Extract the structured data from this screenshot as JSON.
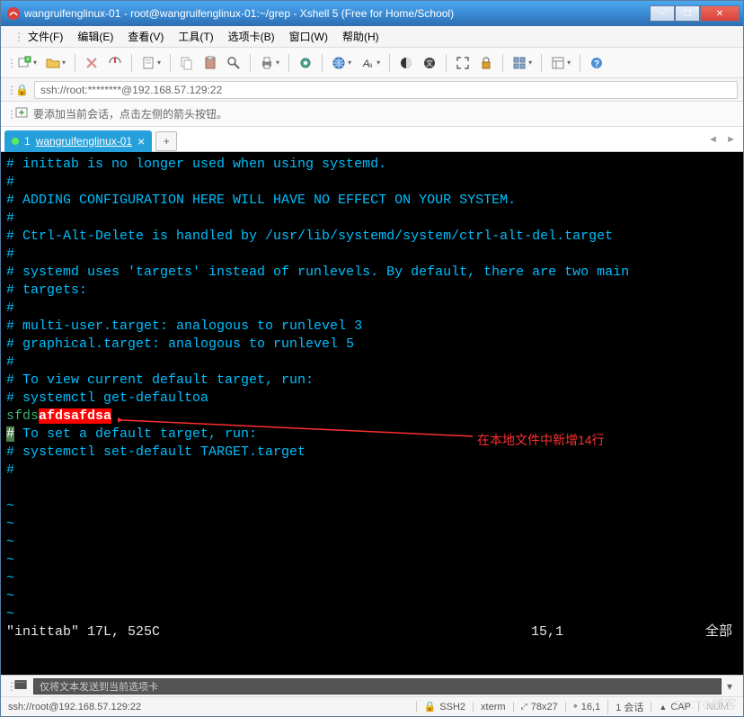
{
  "window": {
    "title": "wangruifenglinux-01 - root@wangruifenglinux-01:~/grep - Xshell 5 (Free for Home/School)"
  },
  "menu": {
    "file": "文件(F)",
    "edit": "编辑(E)",
    "view": "查看(V)",
    "tools": "工具(T)",
    "tabs": "选项卡(B)",
    "window": "窗口(W)",
    "help": "帮助(H)"
  },
  "address": {
    "value": "ssh://root:********@192.168.57.129:22"
  },
  "infobar": {
    "text": "要添加当前会话，点击左侧的箭头按钮。"
  },
  "tab": {
    "index": "1",
    "label": "wangruifenglinux-01"
  },
  "terminal_lines": [
    {
      "t": "# inittab is no longer used when using systemd.",
      "c": "blue"
    },
    {
      "t": "#",
      "c": "blue"
    },
    {
      "t": "# ADDING CONFIGURATION HERE WILL HAVE NO EFFECT ON YOUR SYSTEM.",
      "c": "blue"
    },
    {
      "t": "#",
      "c": "blue"
    },
    {
      "t": "# Ctrl-Alt-Delete is handled by /usr/lib/systemd/system/ctrl-alt-del.target",
      "c": "blue"
    },
    {
      "t": "#",
      "c": "blue"
    },
    {
      "t": "# systemd uses 'targets' instead of runlevels. By default, there are two main",
      "c": "blue"
    },
    {
      "t": "# targets:",
      "c": "blue"
    },
    {
      "t": "#",
      "c": "blue"
    },
    {
      "t": "# multi-user.target: analogous to runlevel 3",
      "c": "blue"
    },
    {
      "t": "# graphical.target: analogous to runlevel 5",
      "c": "blue"
    },
    {
      "t": "#",
      "c": "blue"
    },
    {
      "t": "# To view current default target, run:",
      "c": "blue"
    },
    {
      "t": "# systemctl get-defaultoa",
      "c": "blue"
    },
    {
      "prefix": "sfds",
      "hl": "afdsafdsa",
      "c": "mixed"
    },
    {
      "prefix_hl": "#",
      "rest": " To set a default target, run:",
      "c": "mixed2"
    },
    {
      "t": "# systemctl set-default TARGET.target",
      "c": "blue"
    },
    {
      "t": "#",
      "c": "blue"
    },
    {
      "t": "",
      "c": "blue"
    },
    {
      "t": "~",
      "c": "tilde"
    },
    {
      "t": "~",
      "c": "tilde"
    },
    {
      "t": "~",
      "c": "tilde"
    },
    {
      "t": "~",
      "c": "tilde"
    },
    {
      "t": "~",
      "c": "tilde"
    },
    {
      "t": "~",
      "c": "tilde"
    },
    {
      "t": "~",
      "c": "tilde"
    }
  ],
  "vim_status": {
    "file": "\"inittab\" 17L, 525C",
    "pos": "15,1",
    "scroll": "全部"
  },
  "annotation": {
    "text": "在本地文件中新增14行"
  },
  "inputbar": {
    "placeholder": "仅将文本发送到当前选项卡"
  },
  "statusbar": {
    "left": "ssh://root@192.168.57.129:22",
    "ssh": "SSH2",
    "term": "xterm",
    "size": "78x27",
    "cursor": "16,1",
    "sessions": "1 会话",
    "cap": "CAP",
    "num": "NUM"
  },
  "watermark": "51CTO博客"
}
